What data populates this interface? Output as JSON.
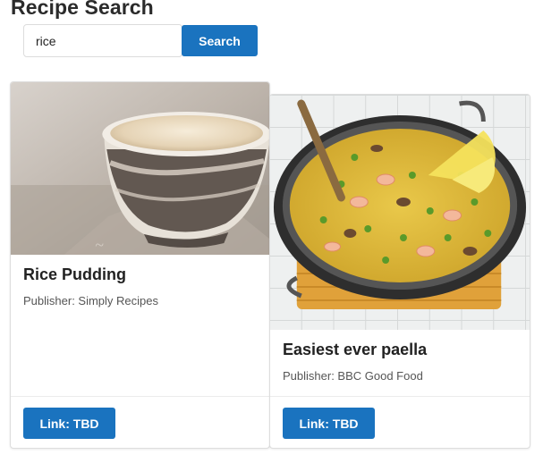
{
  "page": {
    "title": "Recipe Search"
  },
  "search": {
    "value": "rice",
    "button_label": "Search"
  },
  "recipes": [
    {
      "title": "Rice Pudding",
      "publisher": "Publisher: Simply Recipes",
      "link_label": "Link: TBD",
      "image": "rice-pudding-photo"
    },
    {
      "title": "Easiest ever paella",
      "publisher": "Publisher: BBC Good Food",
      "link_label": "Link: TBD",
      "image": "paella-photo"
    }
  ],
  "colors": {
    "primary_button": "#1a73bf",
    "card_border": "#dddddd"
  }
}
